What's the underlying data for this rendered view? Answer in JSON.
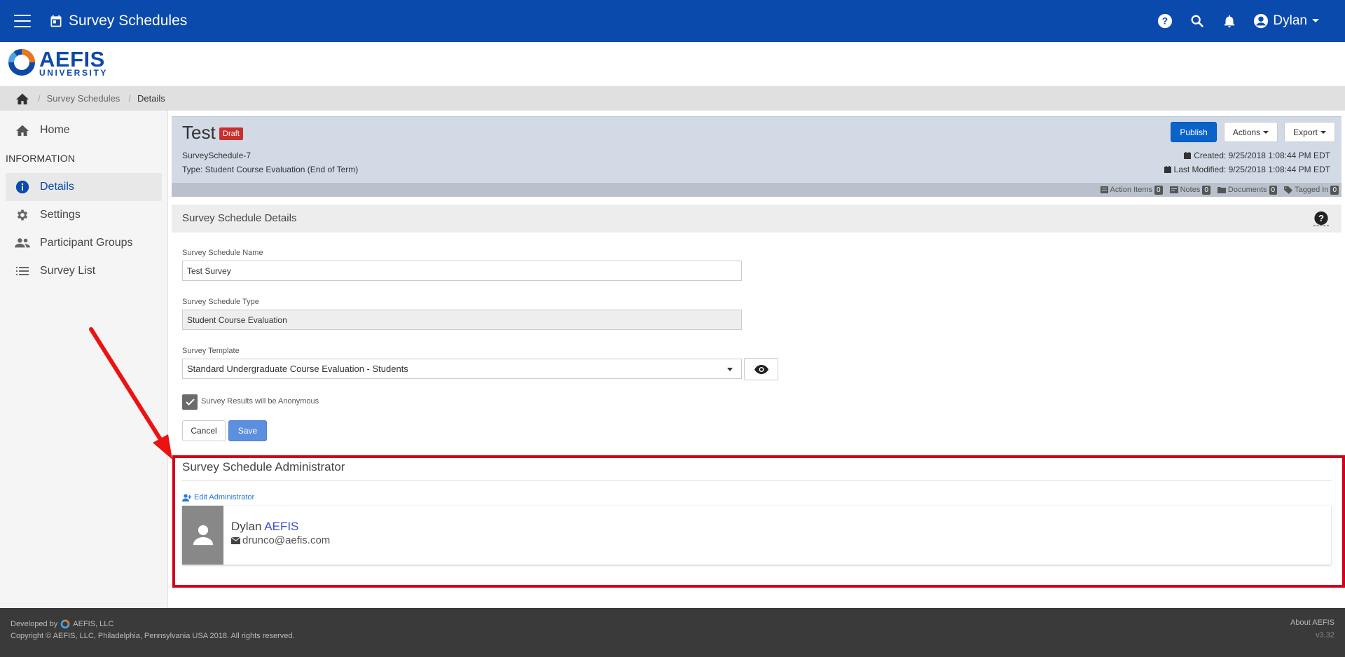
{
  "topbar": {
    "title": "Survey Schedules",
    "user": "Dylan",
    "icons": [
      "menu-icon",
      "calendar-icon",
      "help-icon",
      "search-icon",
      "bell-icon",
      "account-icon",
      "chevron-down-icon"
    ]
  },
  "brand": {
    "name": "AEFIS",
    "sub": "UNIVERSITY",
    "colors": {
      "primary": "#0a4aad",
      "accent": "#e87722",
      "ring": "#0d4aa8"
    }
  },
  "breadcrumb": {
    "items": [
      "Survey Schedules",
      "Details"
    ],
    "separator": "/"
  },
  "sidebar": {
    "home": "Home",
    "section": "INFORMATION",
    "items": [
      {
        "label": "Details",
        "icon": "info-icon",
        "active": true
      },
      {
        "label": "Settings",
        "icon": "gear-icon"
      },
      {
        "label": "Participant Groups",
        "icon": "people-icon"
      },
      {
        "label": "Survey List",
        "icon": "list-icon"
      }
    ]
  },
  "header": {
    "title": "Test",
    "badge": "Draft",
    "id": "SurveySchedule-7",
    "type": "Type: Student Course Evaluation (End of Term)",
    "publish": "Publish",
    "actions": "Actions",
    "export": "Export",
    "created": "Created: 9/25/2018 1:08:44 PM EDT",
    "modified": "Last Modified: 9/25/2018 1:08:44 PM EDT"
  },
  "subbar": {
    "items": [
      {
        "label": "Action Items",
        "count": "0"
      },
      {
        "label": "Notes",
        "count": "0"
      },
      {
        "label": "Documents",
        "count": "0"
      },
      {
        "label": "Tagged In",
        "count": "0"
      }
    ]
  },
  "details": {
    "title": "Survey Schedule Details",
    "name_label": "Survey Schedule Name",
    "name_value": "Test Survey",
    "type_label": "Survey Schedule Type",
    "type_value": "Student Course Evaluation",
    "template_label": "Survey Template",
    "template_value": "Standard Undergraduate Course Evaluation - Students",
    "anonymous_label": "Survey Results will be Anonymous",
    "cancel": "Cancel",
    "save": "Save"
  },
  "admin": {
    "title": "Survey Schedule Administrator",
    "edit": "Edit Administrator",
    "first": "Dylan",
    "last": "AEFIS",
    "email": "drunco@aefis.com"
  },
  "footer": {
    "developed": "Developed by",
    "company": "AEFIS, LLC",
    "copyright": "Copyright © AEFIS, LLC, Philadelphia, Pennsylvania USA 2018. All rights reserved.",
    "about": "About AEFIS",
    "version": "v3.32"
  }
}
